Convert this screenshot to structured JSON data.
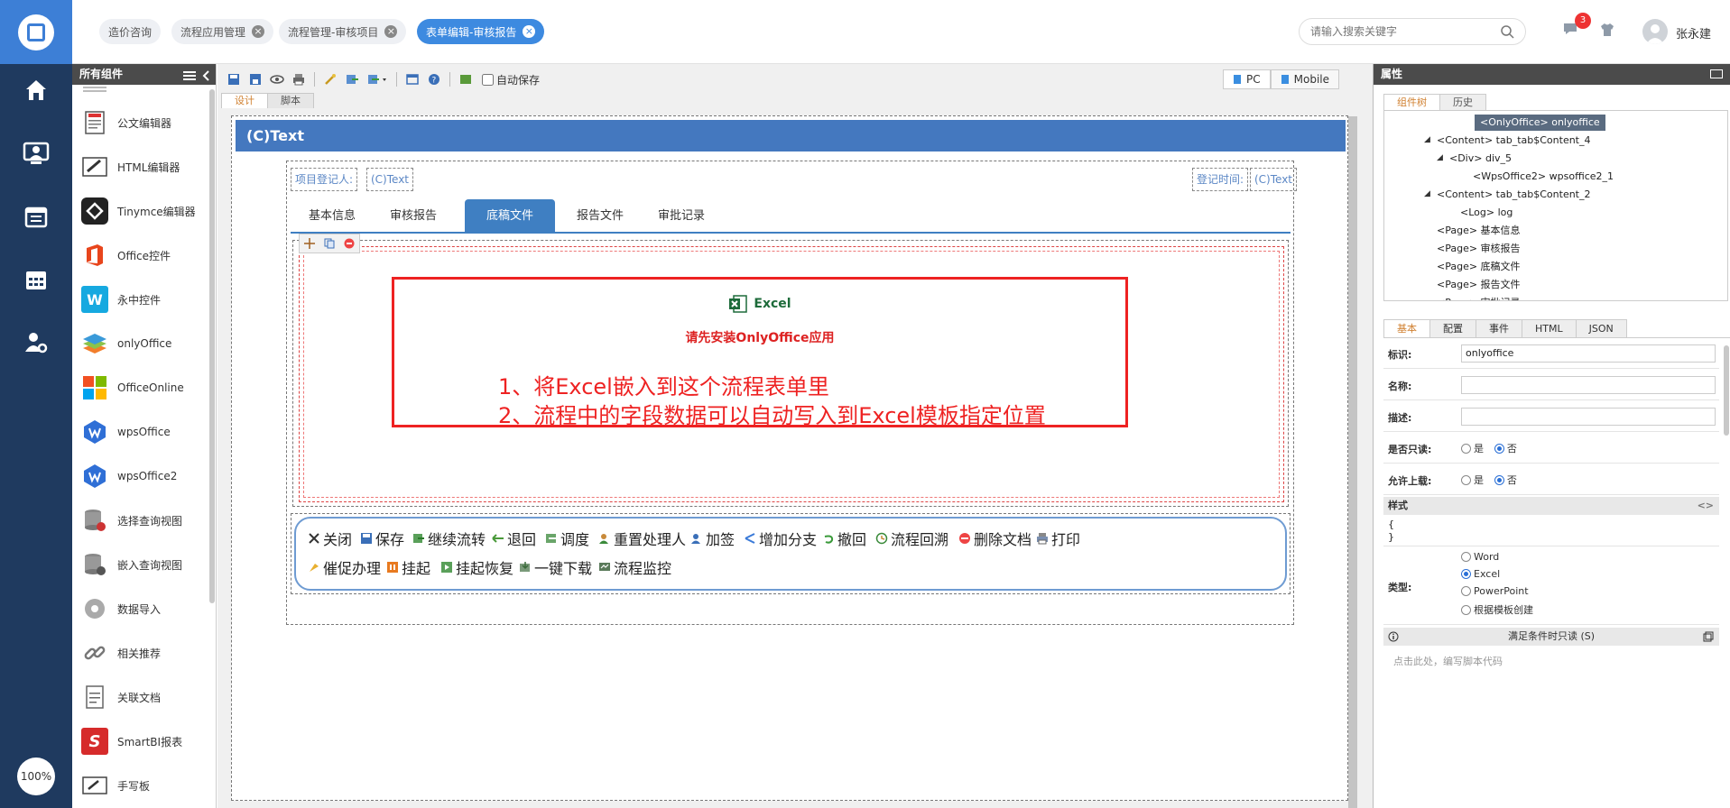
{
  "tabs": [
    {
      "label": "造价咨询",
      "closable": false
    },
    {
      "label": "流程应用管理",
      "closable": true
    },
    {
      "label": "流程管理-审核项目",
      "closable": true
    },
    {
      "label": "表单编辑-审核报告",
      "closable": true,
      "active": true
    }
  ],
  "search": {
    "placeholder": "请输入搜索关键字"
  },
  "notifications": {
    "count": "3"
  },
  "user": {
    "name": "张永建"
  },
  "leftnav": {
    "zoom": "100%",
    "icons": [
      "home-icon",
      "user-monitor-icon",
      "calendar-list-icon",
      "calendar-grid-icon",
      "user-settings-icon"
    ]
  },
  "palette": {
    "title": "所有组件",
    "items": [
      {
        "label": "公文编辑器",
        "icon": "document-editor-icon"
      },
      {
        "label": "HTML编辑器",
        "icon": "html-editor-icon"
      },
      {
        "label": "Tinymce编辑器",
        "icon": "tinymce-icon"
      },
      {
        "label": "Office控件",
        "icon": "office-icon"
      },
      {
        "label": "永中控件",
        "icon": "yozo-icon"
      },
      {
        "label": "onlyOffice",
        "icon": "onlyoffice-icon"
      },
      {
        "label": "OfficeOnline",
        "icon": "office-online-icon"
      },
      {
        "label": "wpsOffice",
        "icon": "wps-icon"
      },
      {
        "label": "wpsOffice2",
        "icon": "wps2-icon"
      },
      {
        "label": "选择查询视图",
        "icon": "select-query-view-icon"
      },
      {
        "label": "嵌入查询视图",
        "icon": "embed-query-view-icon"
      },
      {
        "label": "数据导入",
        "icon": "data-import-icon"
      },
      {
        "label": "相关推荐",
        "icon": "link-icon"
      },
      {
        "label": "关联文档",
        "icon": "linked-document-icon"
      },
      {
        "label": "SmartBI报表",
        "icon": "smartbi-icon"
      },
      {
        "label": "手写板",
        "icon": "handwriting-pad-icon"
      }
    ]
  },
  "toolbar": {
    "autosave_label": "自动保存",
    "pc_label": "PC",
    "mobile_label": "Mobile"
  },
  "editor_tabs": [
    "设计",
    "脚本"
  ],
  "canvas": {
    "title": "(C)Text",
    "field_registrant_label": "项目登记人:",
    "field_registrant_value": "(C)Text",
    "field_time_label": "登记时间:",
    "field_time_value": "(C)Text",
    "form_tabs": [
      "基本信息",
      "审核报告",
      "底稿文件",
      "报告文件",
      "审批记录"
    ],
    "active_form_tab": 2,
    "onlyoffice": {
      "app_label": "Excel",
      "install_msg": "请先安装OnlyOffice应用",
      "note1": "1、将Excel嵌入到这个流程表单里",
      "note2": "2、流程中的字段数据可以自动写入到Excel模板指定位置"
    },
    "actions": [
      {
        "label": "关闭",
        "icon": "close-icon"
      },
      {
        "label": "保存",
        "icon": "save-icon"
      },
      {
        "label": "继续流转",
        "icon": "forward-icon"
      },
      {
        "label": "退回",
        "icon": "back-arrow-icon"
      },
      {
        "label": "调度",
        "icon": "dispatch-icon"
      },
      {
        "label": "重置处理人",
        "icon": "reset-user-icon"
      },
      {
        "label": "加签",
        "icon": "add-sign-icon"
      },
      {
        "label": "增加分支",
        "icon": "branch-icon"
      },
      {
        "label": "撤回",
        "icon": "undo-icon"
      },
      {
        "label": "流程回溯",
        "icon": "history-icon"
      },
      {
        "label": "删除文档",
        "icon": "delete-icon"
      },
      {
        "label": "打印",
        "icon": "print-icon"
      },
      {
        "label": "催促办理",
        "icon": "urge-icon"
      },
      {
        "label": "挂起",
        "icon": "pause-icon"
      },
      {
        "label": "挂起恢复",
        "icon": "resume-icon"
      },
      {
        "label": "一键下载",
        "icon": "download-icon"
      },
      {
        "label": "流程监控",
        "icon": "monitor-icon"
      }
    ]
  },
  "props": {
    "title": "属性",
    "tree_tabs": [
      "组件树",
      "历史"
    ],
    "tree": [
      {
        "text": "<OnlyOffice> onlyoffice",
        "selected": true
      },
      {
        "text": "<Content> tab_tab$Content_4",
        "expander": true
      },
      {
        "text": "<Div> div_5",
        "expander": true
      },
      {
        "text": "<WpsOffice2> wpsoffice2_1"
      },
      {
        "text": "<Content> tab_tab$Content_2",
        "expander": true
      },
      {
        "text": "<Log> log"
      },
      {
        "text": "<Page> 基本信息"
      },
      {
        "text": "<Page> 审核报告"
      },
      {
        "text": "<Page> 底稿文件"
      },
      {
        "text": "<Page> 报告文件"
      },
      {
        "text": "<Page> 审批记录"
      }
    ],
    "prop_tabs": [
      "基本",
      "配置",
      "事件",
      "HTML",
      "JSON"
    ],
    "id_label": "标识:",
    "id_value": "onlyoffice",
    "name_label": "名称:",
    "desc_label": "描述:",
    "readonly_label": "是否只读:",
    "upload_label": "允许上载:",
    "yes": "是",
    "no": "否",
    "style_label": "样式",
    "style_value_open": "{",
    "style_value_close": "}",
    "type_label": "类型:",
    "types": [
      "Word",
      "Excel",
      "PowerPoint",
      "根据模板创建"
    ],
    "type_selected": "Excel",
    "readonly_cond_label": "满足条件时只读 (S)",
    "script_placeholder": "点击此处，编写脚本代码"
  }
}
